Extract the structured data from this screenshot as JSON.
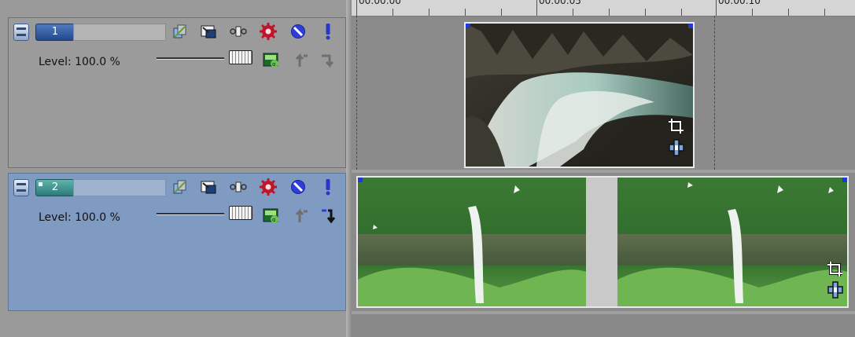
{
  "tracks": [
    {
      "number": "1",
      "name": "",
      "level_label": "Level: 100.0 %",
      "level_percent": 100.0,
      "selected": false
    },
    {
      "number": "2",
      "name": "",
      "level_label": "Level: 100.0 %",
      "level_percent": 100.0,
      "selected": true
    }
  ],
  "ruler": {
    "labels": [
      "00:00:00",
      "00:00:05",
      "00:00:10"
    ]
  },
  "header_icons": [
    "composite-mode-icon",
    "make-compositing-child-icon",
    "track-motion-icon",
    "track-fx-icon",
    "mute-icon",
    "solo-icon"
  ],
  "level_row_icons": [
    "composite-level-icon",
    "make-compositing-parent-icon",
    "make-compositing-child-arrow-icon"
  ],
  "clip_icons": [
    "pan-crop-icon",
    "event-fx-icon"
  ],
  "colors": {
    "selected_track_bg": "#7f9bc2",
    "unselected_track_bg": "#9b9b9b",
    "mute_icon": "#2e3dd6",
    "solo_icon": "#2a36c9",
    "fx_icon": "#c0142a"
  }
}
